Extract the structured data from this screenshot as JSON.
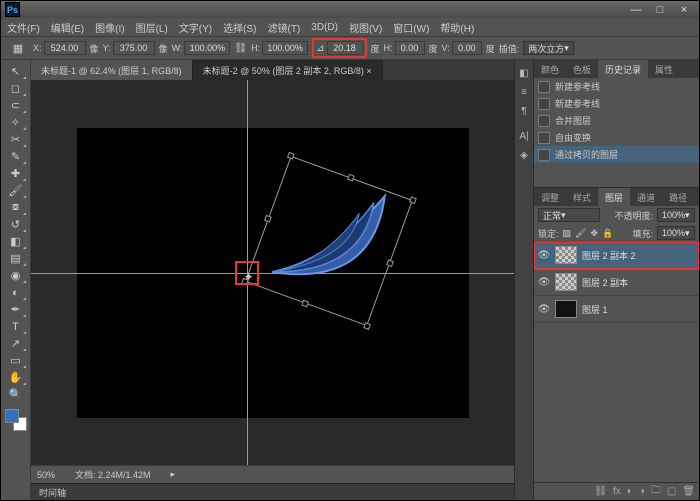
{
  "app": {
    "logo": "Ps"
  },
  "win": {
    "min": "—",
    "max": "□",
    "close": "×"
  },
  "menu": [
    "文件(F)",
    "编辑(E)",
    "图像(I)",
    "图层(L)",
    "文字(Y)",
    "选择(S)",
    "滤镜(T)",
    "3D(D)",
    "视图(V)",
    "窗口(W)",
    "帮助(H)"
  ],
  "opt": {
    "x_lbl": "X:",
    "x": "524.00",
    "px": "像",
    "y_lbl": "Y:",
    "y": "375.00",
    "w_lbl": "W:",
    "w": "100.00%",
    "h_lbl": "H:",
    "h": "100.00%",
    "angle": "20.18",
    "deg1": "度",
    "hskew_lbl": "H:",
    "hskew": "0.00",
    "deg2": "度",
    "vskew_lbl": "V:",
    "vskew": "0.00",
    "deg3": "度",
    "interp_lbl": "插值:",
    "interp": "两次立方"
  },
  "tabs": [
    {
      "label": "未标题-1 @ 62.4% (图层 1, RGB/8)"
    },
    {
      "label": "未标题-2 @ 50%  (图层 2 副本 2, RGB/8) ×"
    }
  ],
  "status": {
    "zoom": "50%",
    "doc": "文档: 2.24M/1.42M"
  },
  "timeline": {
    "label": "时间轴"
  },
  "rpanelTabs": {
    "color": "颜色",
    "swatch": "色板",
    "history": "历史记录",
    "props": "属性"
  },
  "history": [
    {
      "label": "新建参考线"
    },
    {
      "label": "新建参考线"
    },
    {
      "label": "合并图层"
    },
    {
      "label": "自由变换"
    },
    {
      "label": "通过拷贝的图层"
    }
  ],
  "adjTabs": {
    "adjust": "调整",
    "style": "样式",
    "layer": "图层",
    "channel": "通道",
    "path": "路径"
  },
  "layerOps": {
    "mode": "正常",
    "opacity_lbl": "不透明度:",
    "opacity": "100%",
    "lock_lbl": "锁定:",
    "fill_lbl": "填充:",
    "fill": "100%"
  },
  "layers": [
    {
      "name": "图层 2 副本 2",
      "sel": true
    },
    {
      "name": "图层 2 副本"
    },
    {
      "name": "图层 1"
    }
  ],
  "icons": {
    "eye": "👁",
    "trash": "🗑",
    "new": "▢",
    "folder": "🗀",
    "fx": "fx",
    "mask": "◐",
    "adj": "◑"
  }
}
